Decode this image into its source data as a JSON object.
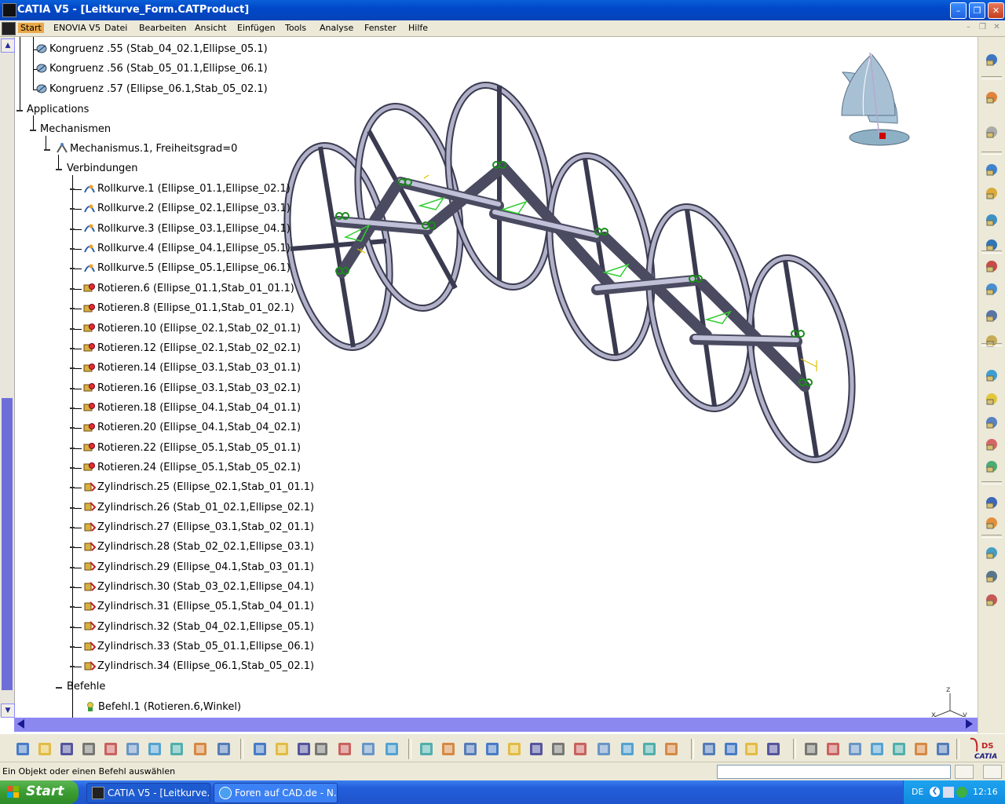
{
  "window": {
    "title": "CATIA V5 - [Leitkurve_Form.CATProduct]"
  },
  "menu": {
    "items": [
      "Start",
      "ENOVIA V5",
      "Datei",
      "Bearbeiten",
      "Ansicht",
      "Einfügen",
      "Tools",
      "Analyse",
      "Fenster",
      "Hilfe"
    ]
  },
  "tree": {
    "kongruenz": [
      "Kongruenz .55 (Stab_04_02.1,Ellipse_05.1)",
      "Kongruenz .56 (Stab_05_01.1,Ellipse_06.1)",
      "Kongruenz .57 (Ellipse_06.1,Stab_05_02.1)"
    ],
    "applications": "Applications",
    "mechanismen": "Mechanismen",
    "mechanismus": "Mechanismus.1, Freiheitsgrad=0",
    "verbindungen": "Verbindungen",
    "joints": [
      {
        "label": "Rollkurve.1 (Ellipse_01.1,Ellipse_02.1)",
        "kind": "roll"
      },
      {
        "label": "Rollkurve.2 (Ellipse_02.1,Ellipse_03.1)",
        "kind": "roll"
      },
      {
        "label": "Rollkurve.3 (Ellipse_03.1,Ellipse_04.1)",
        "kind": "roll"
      },
      {
        "label": "Rollkurve.4 (Ellipse_04.1,Ellipse_05.1)",
        "kind": "roll"
      },
      {
        "label": "Rollkurve.5 (Ellipse_05.1,Ellipse_06.1)",
        "kind": "roll"
      },
      {
        "label": "Rotieren.6 (Ellipse_01.1,Stab_01_01.1)",
        "kind": "rot"
      },
      {
        "label": "Rotieren.8 (Ellipse_01.1,Stab_01_02.1)",
        "kind": "rot"
      },
      {
        "label": "Rotieren.10 (Ellipse_02.1,Stab_02_01.1)",
        "kind": "rot"
      },
      {
        "label": "Rotieren.12 (Ellipse_02.1,Stab_02_02.1)",
        "kind": "rot"
      },
      {
        "label": "Rotieren.14 (Ellipse_03.1,Stab_03_01.1)",
        "kind": "rot"
      },
      {
        "label": "Rotieren.16 (Ellipse_03.1,Stab_03_02.1)",
        "kind": "rot"
      },
      {
        "label": "Rotieren.18 (Ellipse_04.1,Stab_04_01.1)",
        "kind": "rot"
      },
      {
        "label": "Rotieren.20 (Ellipse_04.1,Stab_04_02.1)",
        "kind": "rot"
      },
      {
        "label": "Rotieren.22 (Ellipse_05.1,Stab_05_01.1)",
        "kind": "rot"
      },
      {
        "label": "Rotieren.24 (Ellipse_05.1,Stab_05_02.1)",
        "kind": "rot"
      },
      {
        "label": "Zylindrisch.25 (Ellipse_02.1,Stab_01_01.1)",
        "kind": "cyl"
      },
      {
        "label": "Zylindrisch.26 (Stab_01_02.1,Ellipse_02.1)",
        "kind": "cyl"
      },
      {
        "label": "Zylindrisch.27 (Ellipse_03.1,Stab_02_01.1)",
        "kind": "cyl"
      },
      {
        "label": "Zylindrisch.28 (Stab_02_02.1,Ellipse_03.1)",
        "kind": "cyl"
      },
      {
        "label": "Zylindrisch.29 (Ellipse_04.1,Stab_03_01.1)",
        "kind": "cyl"
      },
      {
        "label": "Zylindrisch.30 (Stab_03_02.1,Ellipse_04.1)",
        "kind": "cyl"
      },
      {
        "label": "Zylindrisch.31 (Ellipse_05.1,Stab_04_01.1)",
        "kind": "cyl"
      },
      {
        "label": "Zylindrisch.32 (Stab_04_02.1,Ellipse_05.1)",
        "kind": "cyl"
      },
      {
        "label": "Zylindrisch.33 (Stab_05_01.1,Ellipse_06.1)",
        "kind": "cyl"
      },
      {
        "label": "Zylindrisch.34 (Ellipse_06.1,Stab_05_02.1)",
        "kind": "cyl"
      }
    ],
    "befehle": "Befehle",
    "befehl1": "Befehl.1 (Rotieren.6,Winkel)"
  },
  "viewport": {
    "axis_z": "z",
    "axis_x": "x",
    "axis_y": "y"
  },
  "status": {
    "message": "Ein Objekt oder einen Befehl auswählen"
  },
  "brand": {
    "logo": "CATIA"
  },
  "taskbar": {
    "start": "Start",
    "tasks": [
      "CATIA V5 - [Leitkurve...",
      "Foren auf CAD.de - N..."
    ],
    "language": "DE",
    "clock": "12:16"
  },
  "colors": {
    "title": "#0048c8",
    "menu_bg": "#ece9d8",
    "scroll": "#8b89f0",
    "taskbar": "#245edb",
    "start": "#3b9d32"
  }
}
